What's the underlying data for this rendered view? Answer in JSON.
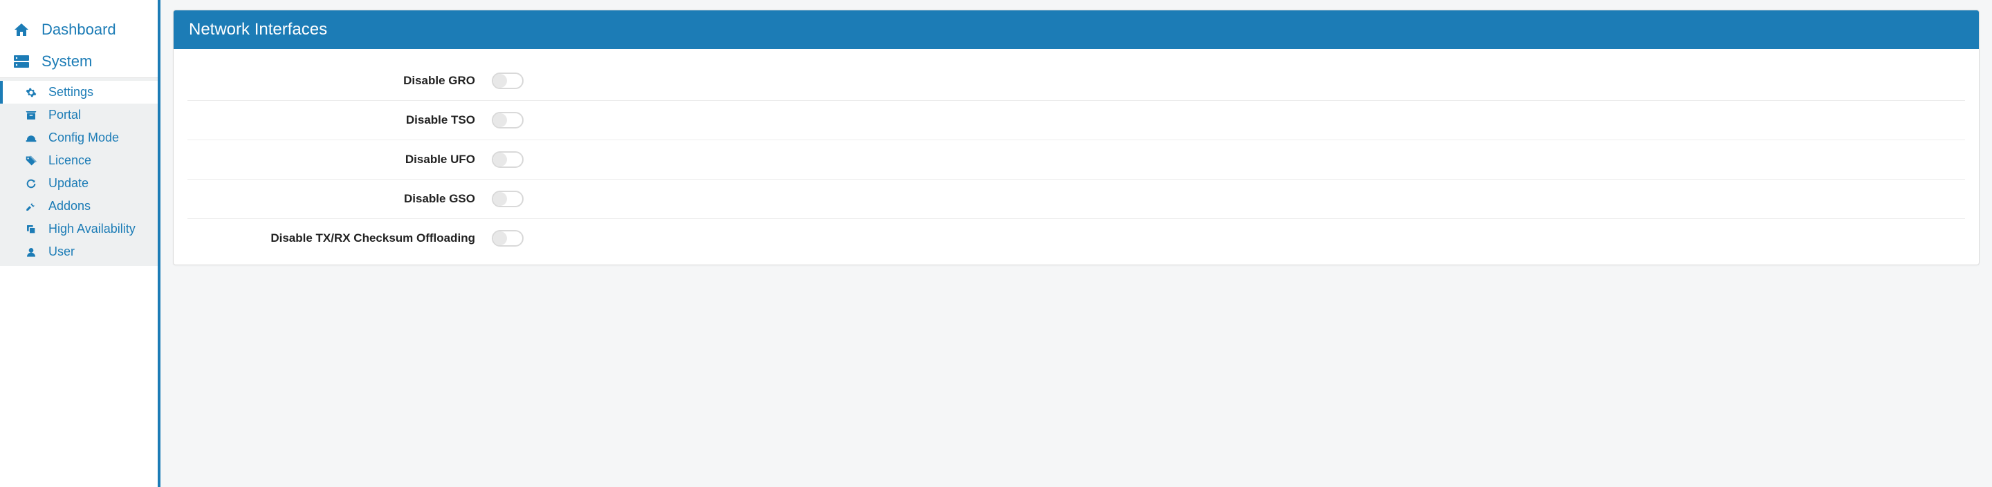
{
  "sidebar": {
    "top": [
      {
        "label": "Dashboard",
        "icon": "home"
      },
      {
        "label": "System",
        "icon": "server"
      }
    ],
    "submenu": [
      {
        "label": "Settings",
        "icon": "gear",
        "active": true
      },
      {
        "label": "Portal",
        "icon": "archive",
        "active": false
      },
      {
        "label": "Config Mode",
        "icon": "hardhat",
        "active": false
      },
      {
        "label": "Licence",
        "icon": "tag",
        "active": false
      },
      {
        "label": "Update",
        "icon": "refresh",
        "active": false
      },
      {
        "label": "Addons",
        "icon": "tools",
        "active": false
      },
      {
        "label": "High Availability",
        "icon": "copy",
        "active": false
      },
      {
        "label": "User",
        "icon": "user",
        "active": false
      }
    ]
  },
  "panel": {
    "title": "Network Interfaces",
    "rows": [
      {
        "label": "Disable GRO",
        "value": false
      },
      {
        "label": "Disable TSO",
        "value": false
      },
      {
        "label": "Disable UFO",
        "value": false
      },
      {
        "label": "Disable GSO",
        "value": false
      },
      {
        "label": "Disable TX/RX Checksum Offloading",
        "value": false
      }
    ]
  },
  "colors": {
    "accent": "#1c7cb6"
  }
}
